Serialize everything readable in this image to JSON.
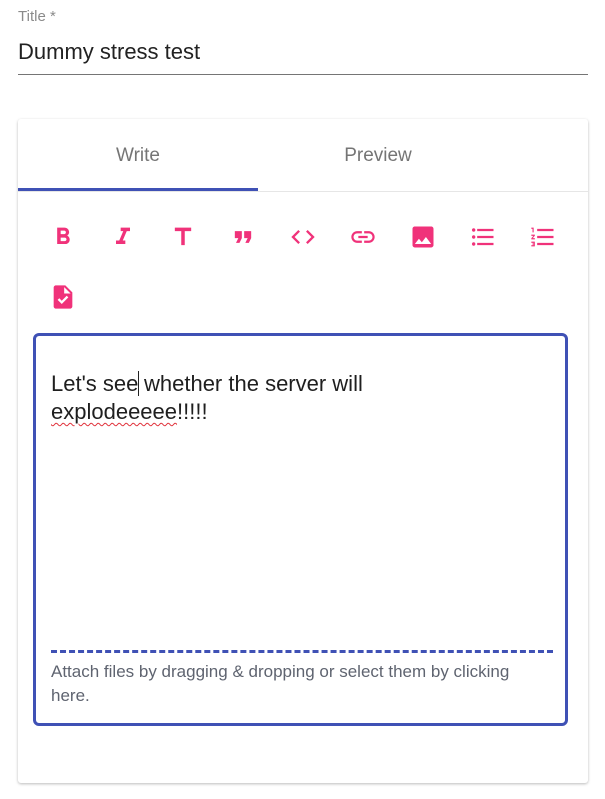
{
  "title_field": {
    "label": "Title *",
    "value": "Dummy stress test"
  },
  "tabs": [
    {
      "label": "Write",
      "active": true
    },
    {
      "label": "Preview",
      "active": false
    }
  ],
  "toolbar": {
    "icon_color": "#f0327a",
    "buttons": [
      "bold-icon",
      "italic-icon",
      "heading-icon",
      "quote-icon",
      "code-icon",
      "link-icon",
      "image-icon",
      "bulleted-list-icon",
      "numbered-list-icon",
      "task-list-icon"
    ]
  },
  "editor": {
    "text_before_caret": "Let's see",
    "text_after_caret": " whether the server will",
    "misspelled_word": "explodeeeee",
    "text_end": "!!!!!",
    "attach_hint": "Attach files by dragging & dropping or select them by clicking here."
  },
  "colors": {
    "accent": "#3f51b5",
    "icon": "#f0327a"
  }
}
